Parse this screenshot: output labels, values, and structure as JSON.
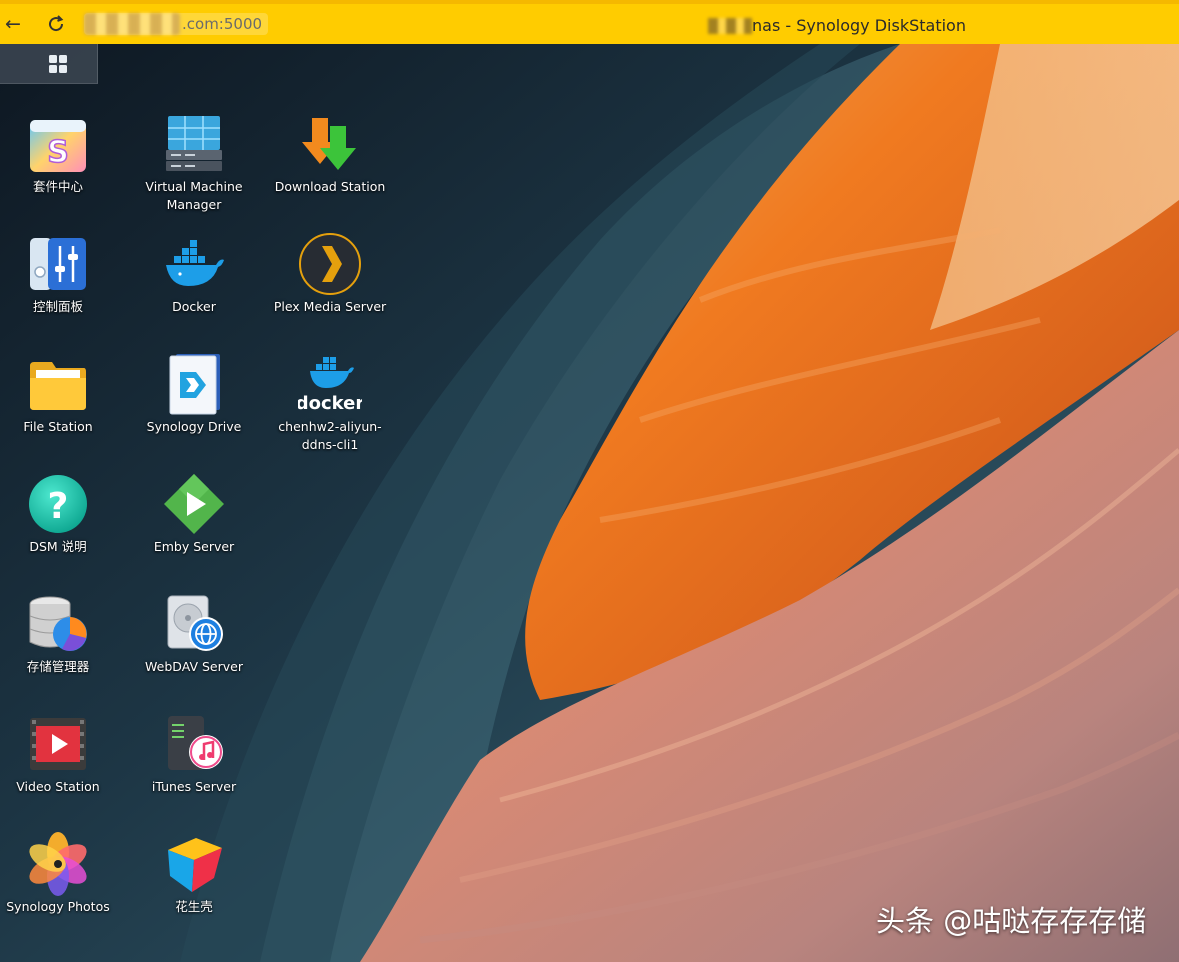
{
  "browser": {
    "url_visible": ".com:5000",
    "tab_title": "nas - Synology DiskStation",
    "bar_color": "#ffcc00"
  },
  "taskbar": {
    "main_menu_icon": "grid-icon"
  },
  "desktop": {
    "apps": [
      {
        "label": "套件中心",
        "icon": "package-center-icon"
      },
      {
        "label": "控制面板",
        "icon": "control-panel-icon"
      },
      {
        "label": "File Station",
        "icon": "folder-icon"
      },
      {
        "label": "DSM 说明",
        "icon": "help-icon"
      },
      {
        "label": "存储管理器",
        "icon": "storage-manager-icon"
      },
      {
        "label": "Video Station",
        "icon": "video-icon"
      },
      {
        "label": "Synology Photos",
        "icon": "photos-icon"
      },
      {
        "label": "Virtual Machine Manager",
        "icon": "vm-manager-icon"
      },
      {
        "label": "Docker",
        "icon": "docker-icon"
      },
      {
        "label": "Synology Drive",
        "icon": "drive-icon"
      },
      {
        "label": "Emby Server",
        "icon": "emby-icon"
      },
      {
        "label": "WebDAV Server",
        "icon": "webdav-icon"
      },
      {
        "label": "iTunes Server",
        "icon": "itunes-icon"
      },
      {
        "label": "花生壳",
        "icon": "peanut-shell-icon"
      },
      {
        "label": "Download Station",
        "icon": "download-icon"
      },
      {
        "label": "Plex Media Server",
        "icon": "plex-icon"
      },
      {
        "label": "chenhw2-aliyun-ddns-cli1",
        "icon": "docker-container-icon",
        "logo_text": "docker"
      }
    ]
  },
  "watermark": "头条 @咕哒存存存储"
}
